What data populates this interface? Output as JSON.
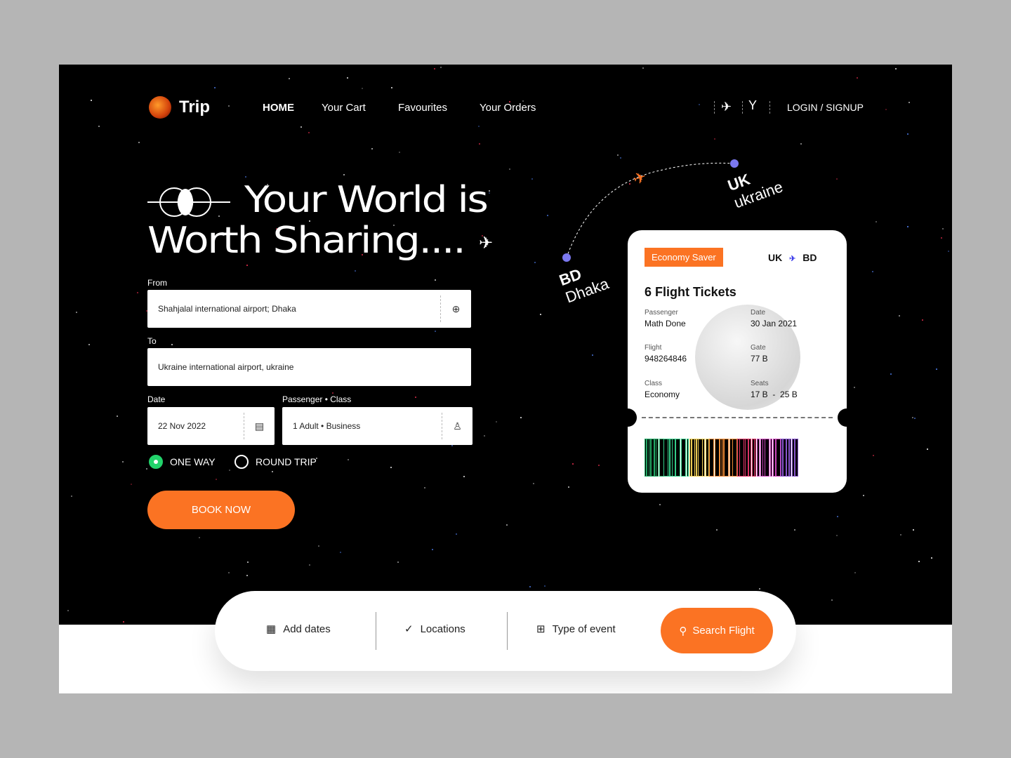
{
  "brand": {
    "name": "Trip",
    "accent": "#fb7323",
    "success": "#22d36b",
    "route_dot": "#7b78f0"
  },
  "nav": {
    "items": [
      "HOME",
      "Your Cart",
      "Favourites",
      "Your Orders"
    ],
    "login": "LOGIN / SIGNUP",
    "icons": [
      "plane-icon",
      "route-split-icon"
    ]
  },
  "hero": {
    "title_line1": "Your World is",
    "title_line2": "Worth Sharing...."
  },
  "form": {
    "from_label": "From",
    "from_value": "Shahjalal international airport; Dhaka",
    "to_label": "To",
    "to_value": "Ukraine international airport, ukraine",
    "date_label": "Date",
    "date_value": "22 Nov 2022",
    "passenger_label": "Passenger • Class",
    "passenger_value": "1 Adult • Business",
    "trip_options": [
      "ONE WAY",
      "ROUND TRIP"
    ],
    "selected_trip": "ONE WAY",
    "book_label": "BOOK NOW"
  },
  "route": {
    "origin_code": "BD",
    "origin_city": "Dhaka",
    "dest_code": "UK",
    "dest_city": "ukraine"
  },
  "ticket": {
    "badge": "Economy Saver",
    "from": "UK",
    "to": "BD",
    "title": "6 Flight Tickets",
    "fields": [
      {
        "label": "Passenger",
        "value": "Math Done"
      },
      {
        "label": "Date",
        "value": "30 Jan 2021"
      },
      {
        "label": "Flight",
        "value": "948264846"
      },
      {
        "label": "Gate",
        "value": "77 B"
      },
      {
        "label": "Class",
        "value": "Economy"
      },
      {
        "label": "Seats",
        "value": "17 B  -  25 B"
      }
    ]
  },
  "searchbar": {
    "items": [
      "Add dates",
      "Locations",
      "Type of event"
    ],
    "button": "Search Flight"
  }
}
